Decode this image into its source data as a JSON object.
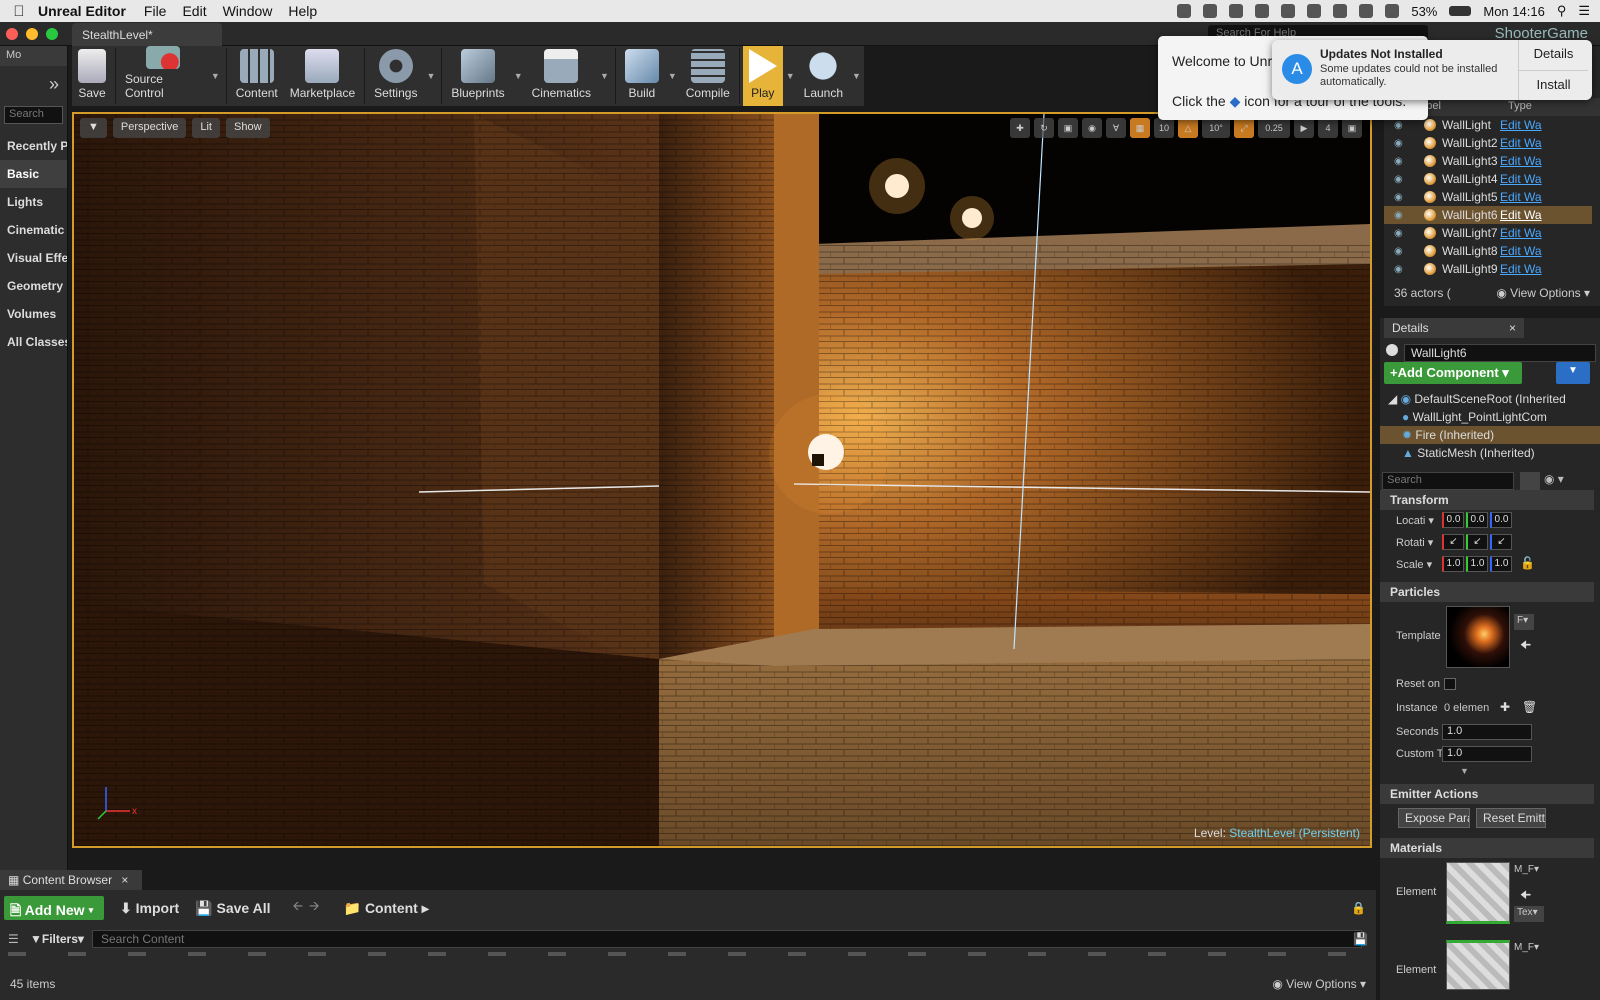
{
  "menubar": {
    "app": "Unreal Editor",
    "menus": [
      "File",
      "Edit",
      "Window",
      "Help"
    ],
    "battery": "53%",
    "clock": "Mon 14:16"
  },
  "window": {
    "level_tab": "StealthLevel*",
    "help_search_placeholder": "Search For Help",
    "project": "ShooterGame"
  },
  "modes": {
    "tab": "Mo",
    "search_placeholder": "Search",
    "categories": [
      "Recently P",
      "Basic",
      "Lights",
      "Cinematic",
      "Visual Effe",
      "Geometry",
      "Volumes",
      "All Classes"
    ]
  },
  "toolbar": {
    "save": "Save",
    "source_control": "Source Control",
    "content": "Content",
    "marketplace": "Marketplace",
    "settings": "Settings",
    "blueprints": "Blueprints",
    "cinematics": "Cinematics",
    "build": "Build",
    "compile": "Compile",
    "play": "Play",
    "launch": "Launch"
  },
  "viewport": {
    "perspective": "Perspective",
    "lit": "Lit",
    "show": "Show",
    "snap_grid": "10",
    "snap_rot": "10°",
    "snap_scale": "0.25",
    "cam_speed": "4",
    "level_label": "Level:",
    "level_name": "StealthLevel (Persistent)"
  },
  "notifications": {
    "welcome_line1": "Welcome to Unr",
    "welcome_line2a": "Click the",
    "welcome_line2b": "icon for a tour of the tools.",
    "update_title": "Updates Not Installed",
    "update_sub": "Some updates could not be installed automatically.",
    "details": "Details",
    "install": "Install"
  },
  "outliner": {
    "col_label": "Label",
    "col_type": "Type",
    "rows": [
      {
        "name": "WallLight",
        "type": "Edit Wa"
      },
      {
        "name": "WallLight2",
        "type": "Edit Wa"
      },
      {
        "name": "WallLight3",
        "type": "Edit Wa"
      },
      {
        "name": "WallLight4",
        "type": "Edit Wa"
      },
      {
        "name": "WallLight5",
        "type": "Edit Wa"
      },
      {
        "name": "WallLight6",
        "type": "Edit Wa"
      },
      {
        "name": "WallLight7",
        "type": "Edit Wa"
      },
      {
        "name": "WallLight8",
        "type": "Edit Wa"
      },
      {
        "name": "WallLight9",
        "type": "Edit Wa"
      }
    ],
    "selected_index": 5,
    "actor_count": "36 actors (",
    "view_options": "View Options"
  },
  "details": {
    "tab": "Details",
    "actor_name": "WallLight6",
    "add_component": "+Add Component",
    "components": [
      "DefaultSceneRoot (Inherited",
      "WallLight_PointLightCom",
      "Fire (Inherited)",
      "StaticMesh (Inherited)"
    ],
    "search_placeholder": "Search",
    "transform": "Transform",
    "location": "Locati",
    "rotation": "Rotati",
    "scale": "Scale",
    "loc_values": [
      "0.0",
      "0.0",
      "0.0"
    ],
    "scale_values": [
      "1.0",
      "1.0",
      "1.0"
    ],
    "particles": "Particles",
    "template": "Template",
    "template_picker": "F",
    "reset_on": "Reset on",
    "instance": "Instance",
    "instance_value": "0 elemen",
    "seconds": "Seconds",
    "seconds_value": "1.0",
    "custom": "Custom T",
    "custom_value": "1.0",
    "emitter_actions": "Emitter Actions",
    "expose_params": "Expose Para",
    "reset_emitter": "Reset Emitte",
    "materials": "Materials",
    "element": "Element",
    "mat_name": "M_F",
    "tex_label": "Tex"
  },
  "content_browser": {
    "tab": "Content Browser",
    "add_new": "Add New",
    "import": "Import",
    "save_all": "Save All",
    "path": "Content",
    "filters": "Filters",
    "search_placeholder": "Search Content",
    "items": "45 items",
    "view_options": "View Options"
  }
}
